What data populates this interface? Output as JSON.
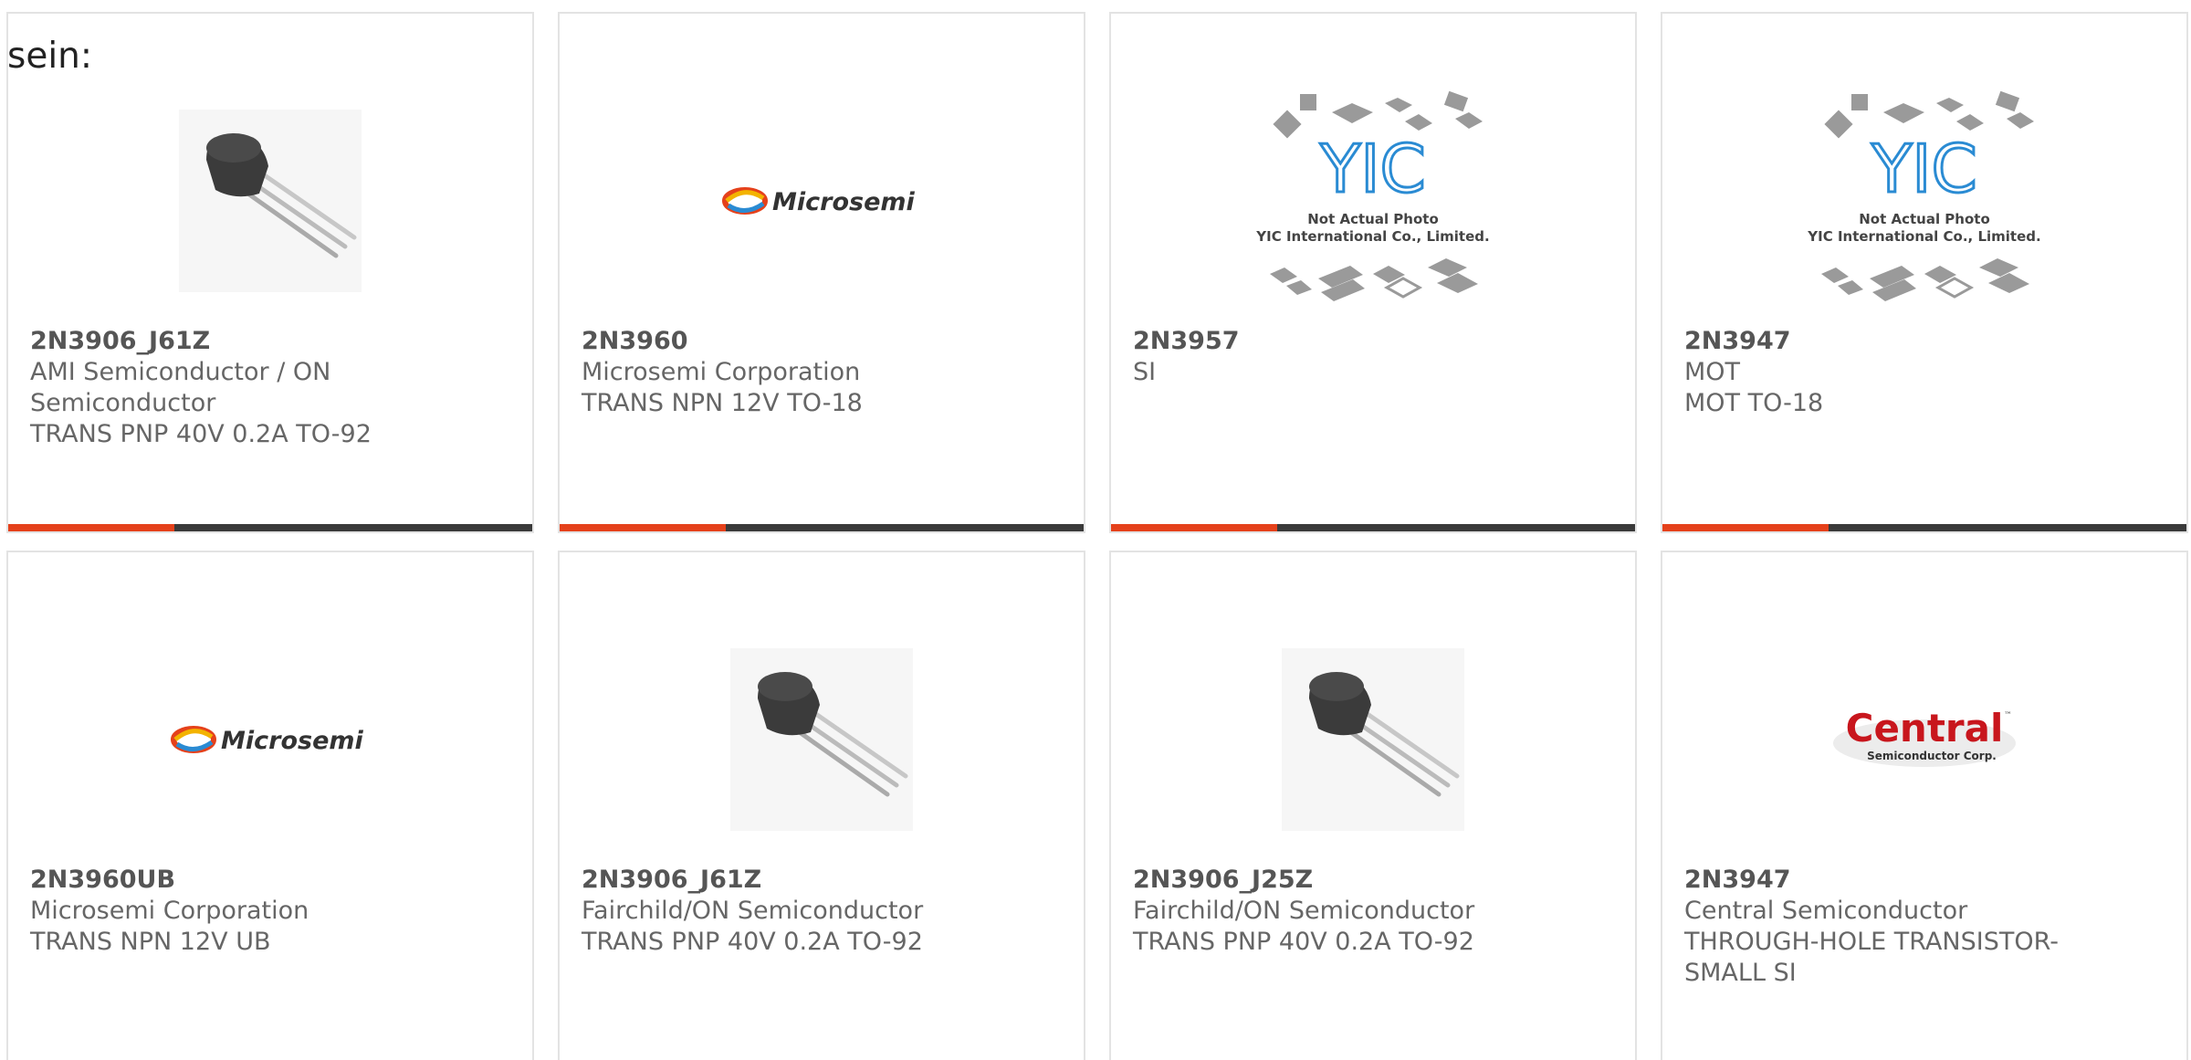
{
  "intro": {
    "text": "sein:"
  },
  "colors": {
    "accent": "#e5411b",
    "bar": "#3a3a3a",
    "card_border": "#e3e3e3",
    "text": "#666666"
  },
  "products": [
    {
      "part": "2N3906_J61Z",
      "manufacturer": "AMI Semiconductor / ON Semiconductor",
      "description": "TRANS PNP 40V 0.2A TO-92",
      "image": "to92-transistor-photo"
    },
    {
      "part": "2N3960",
      "manufacturer": "Microsemi Corporation",
      "description": "TRANS NPN 12V TO-18",
      "image": "microsemi-logo",
      "logo_text": "Microsemi"
    },
    {
      "part": "2N3957",
      "manufacturer": "SI",
      "description": "",
      "image": "yic-placeholder",
      "logo_text": "YIC",
      "caption_line1": "Not Actual Photo",
      "caption_line2": "YIC International Co., Limited."
    },
    {
      "part": "2N3947",
      "manufacturer": "MOT",
      "description": "MOT TO-18",
      "image": "yic-placeholder",
      "logo_text": "YIC",
      "caption_line1": "Not Actual Photo",
      "caption_line2": "YIC International Co., Limited."
    },
    {
      "part": "2N3960UB",
      "manufacturer": "Microsemi Corporation",
      "description": "TRANS NPN 12V UB",
      "image": "microsemi-logo",
      "logo_text": "Microsemi"
    },
    {
      "part": "2N3906_J61Z",
      "manufacturer": "Fairchild/ON Semiconductor",
      "description": "TRANS PNP 40V 0.2A TO-92",
      "image": "to92-transistor-photo"
    },
    {
      "part": "2N3906_J25Z",
      "manufacturer": "Fairchild/ON Semiconductor",
      "description": "TRANS PNP 40V 0.2A TO-92",
      "image": "to92-transistor-photo"
    },
    {
      "part": "2N3947",
      "manufacturer": "Central Semiconductor",
      "description": "THROUGH-HOLE TRANSISTOR-SMALL SI",
      "image": "central-logo",
      "logo_text": "Central",
      "logo_subtext": "Semiconductor Corp.",
      "logo_tm": "™"
    }
  ]
}
